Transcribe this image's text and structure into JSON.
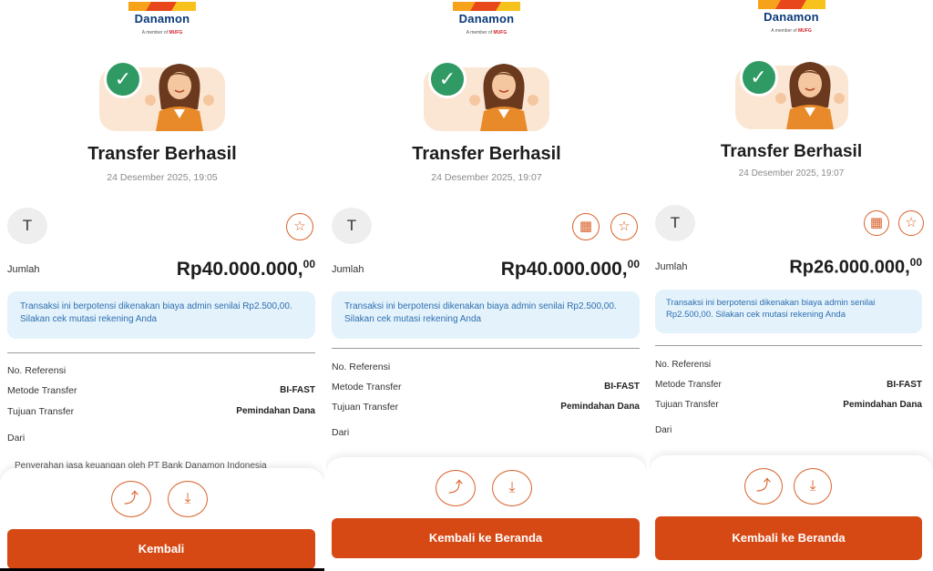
{
  "colors": {
    "accent": "#d64915",
    "success": "#2f9a63",
    "notice_bg": "#e3f2fb",
    "notice_text": "#2f6fb0",
    "brand_blue": "#0b3a7a"
  },
  "brand": {
    "name": "Danamon",
    "sub_prefix": "A member of",
    "sub_group": "MUFG"
  },
  "icons": {
    "success": "check-icon",
    "favorite": "star-icon",
    "schedule": "calendar-icon",
    "share": "share-icon",
    "download": "download-icon"
  },
  "panels": [
    {
      "title": "Transfer Berhasil",
      "datetime": "24 Desember 2025, 19:05",
      "avatar": "T",
      "amount_label": "Jumlah",
      "amount": "Rp40.000.000,",
      "amount_cents": "00",
      "notice": "Transaksi ini berpotensi dikenakan biaya admin senilai Rp2.500,00. Silakan cek mutasi rekening Anda",
      "details": [
        {
          "label": "No. Referensi",
          "value": ""
        },
        {
          "label": "Metode Transfer",
          "value": "BI-FAST"
        },
        {
          "label": "Tujuan Transfer",
          "value": "Pemindahan Dana"
        },
        {
          "label": "Dari",
          "value": ""
        }
      ],
      "footer_text": "Penyerahan jasa keuangan oleh PT Bank Danamon Indonesia",
      "button": "Kembali"
    },
    {
      "title": "Transfer Berhasil",
      "datetime": "24 Desember 2025, 19:07",
      "avatar": "T",
      "amount_label": "Jumlah",
      "amount": "Rp40.000.000,",
      "amount_cents": "00",
      "notice": "Transaksi ini berpotensi dikenakan biaya admin senilai Rp2.500,00. Silakan cek mutasi rekening Anda",
      "details": [
        {
          "label": "No. Referensi",
          "value": ""
        },
        {
          "label": "Metode Transfer",
          "value": "BI-FAST"
        },
        {
          "label": "Tujuan Transfer",
          "value": "Pemindahan Dana"
        },
        {
          "label": "Dari",
          "value": ""
        }
      ],
      "button": "Kembali ke Beranda"
    },
    {
      "title": "Transfer Berhasil",
      "datetime": "24 Desember 2025, 19:07",
      "avatar": "T",
      "amount_label": "Jumlah",
      "amount": "Rp26.000.000,",
      "amount_cents": "00",
      "notice": "Transaksi ini berpotensi dikenakan biaya admin senilai Rp2.500,00. Silakan cek mutasi rekening Anda",
      "details": [
        {
          "label": "No. Referensi",
          "value": ""
        },
        {
          "label": "Metode Transfer",
          "value": "BI-FAST"
        },
        {
          "label": "Tujuan Transfer",
          "value": "Pemindahan Dana"
        },
        {
          "label": "Dari",
          "value": ""
        }
      ],
      "button": "Kembali ke Beranda"
    }
  ]
}
